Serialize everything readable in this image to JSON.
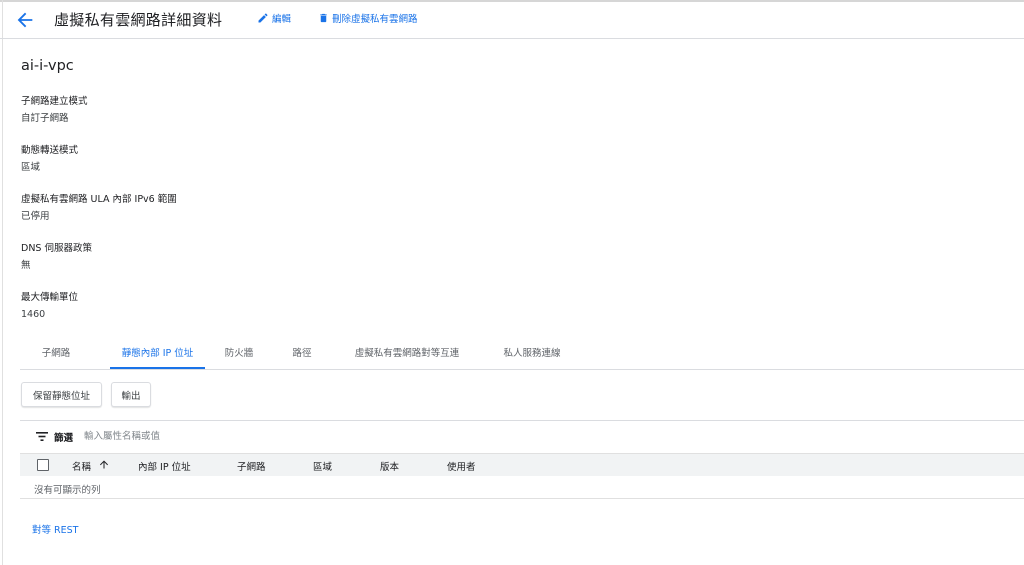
{
  "header": {
    "title": "虛擬私有雲網路詳細資料",
    "edit_label": "編輯",
    "delete_label": "刪除虛擬私有雲網路"
  },
  "vpc": {
    "name": "ai-i-vpc",
    "details": [
      {
        "label": "子網路建立模式",
        "value": "自訂子網路"
      },
      {
        "label": "動態轉送模式",
        "value": "區域"
      },
      {
        "label": "虛擬私有雲網路 ULA 內部 IPv6 範圍",
        "value": "已停用"
      },
      {
        "label": "DNS 伺服器政策",
        "value": "無"
      },
      {
        "label": "最大傳輸單位",
        "value": "1460"
      }
    ]
  },
  "tabs": [
    {
      "label": "子網路"
    },
    {
      "label": "靜態內部 IP 位址",
      "active": true
    },
    {
      "label": "防火牆"
    },
    {
      "label": "路徑"
    },
    {
      "label": "虛擬私有雲網路對等互連"
    },
    {
      "label": "私人服務連線"
    }
  ],
  "actions": {
    "reserve_label": "保留靜態位址",
    "export_label": "輸出"
  },
  "filter": {
    "label": "篩選",
    "placeholder": "輸入屬性名稱或值"
  },
  "table": {
    "columns": [
      "名稱",
      "內部 IP 位址",
      "子網路",
      "區域",
      "版本",
      "使用者"
    ],
    "sort_column": "名稱",
    "empty_message": "沒有可顯示的列"
  },
  "footer": {
    "rest_link": "對等 REST"
  },
  "colors": {
    "accent": "#1a73e8",
    "text": "#202124",
    "muted": "#5f6368",
    "border": "#dadce0",
    "table_header_bg": "#f1f3f4"
  },
  "icons": {
    "back": "arrow-left",
    "edit": "pencil",
    "delete": "trash",
    "filter": "filter-lines",
    "sort": "arrow-up"
  }
}
